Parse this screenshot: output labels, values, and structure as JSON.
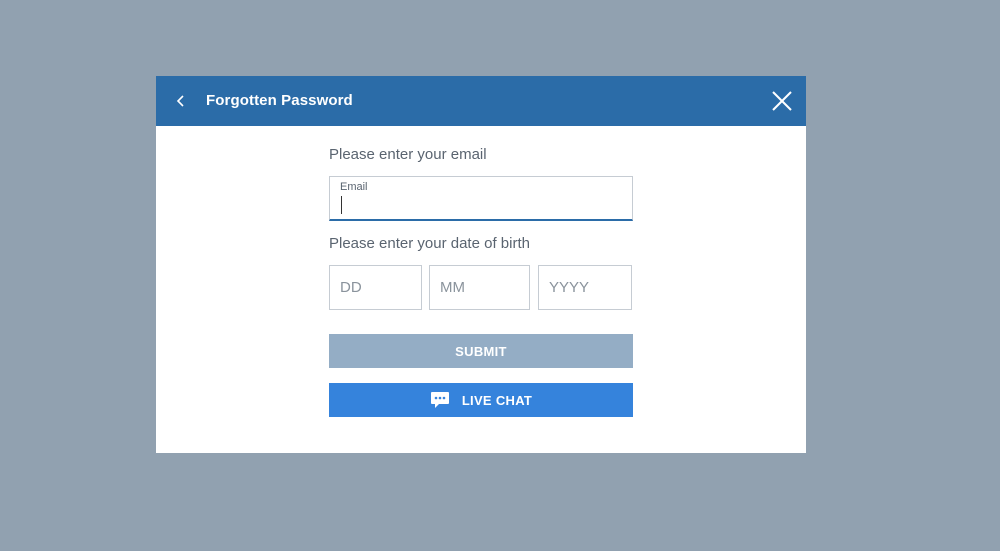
{
  "header": {
    "title": "Forgotten Password",
    "back_icon": "chevron-left-icon",
    "close_icon": "close-icon",
    "background_color": "#2b6ca8"
  },
  "form": {
    "email_prompt": "Please enter your email",
    "email_label": "Email",
    "email_value": "",
    "dob_prompt": "Please enter your date of birth",
    "dob_day_placeholder": "DD",
    "dob_month_placeholder": "MM",
    "dob_year_placeholder": "YYYY"
  },
  "buttons": {
    "submit_label": "SUBMIT",
    "submit_color": "#94adc5",
    "live_chat_label": "LIVE CHAT",
    "live_chat_color": "#3583dc",
    "live_chat_icon": "chat-bubble-icon"
  }
}
